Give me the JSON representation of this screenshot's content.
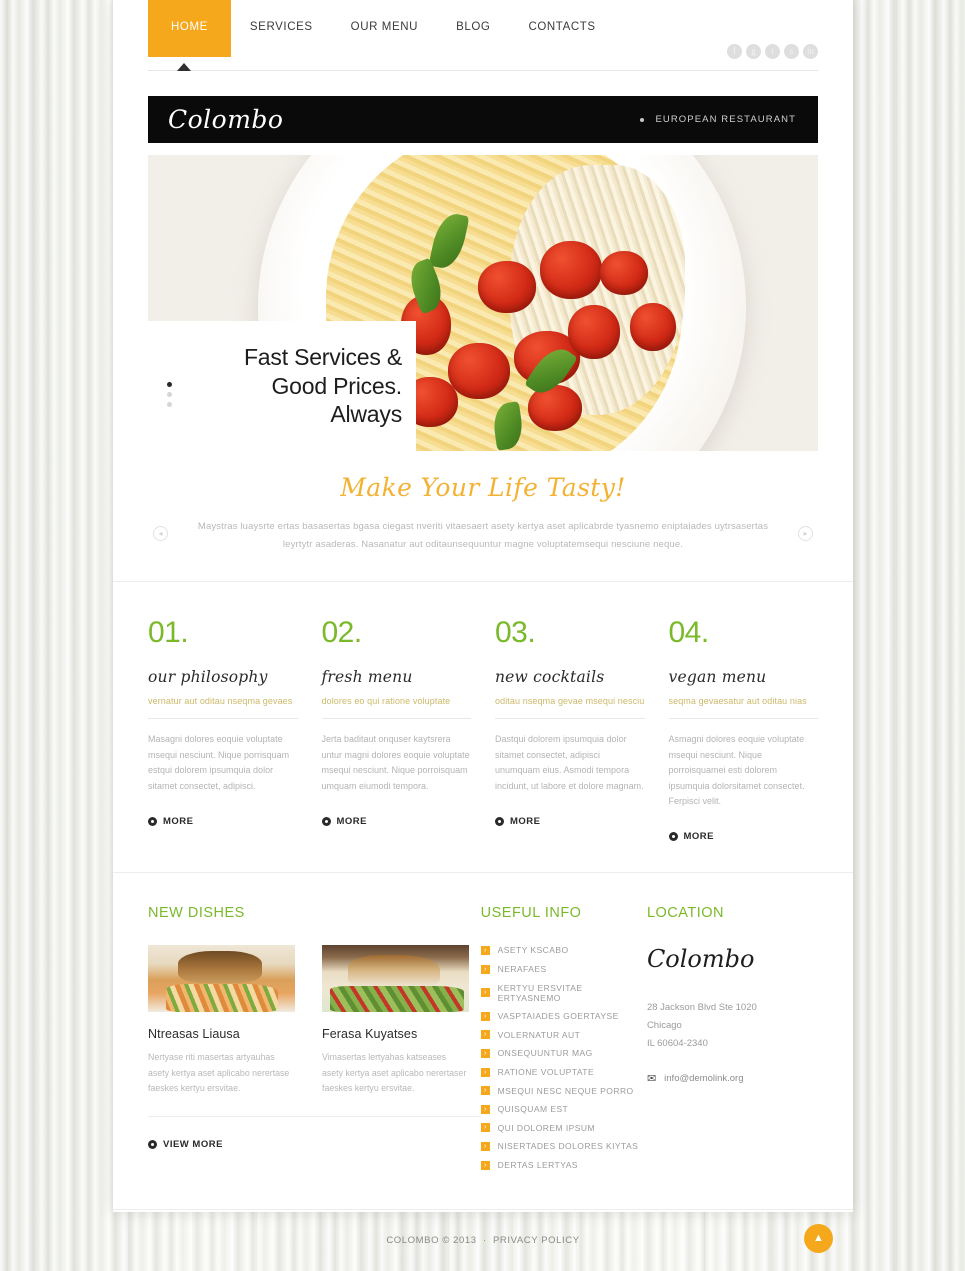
{
  "nav": {
    "items": [
      {
        "label": "HOME",
        "active": true
      },
      {
        "label": "SERVICES",
        "active": false
      },
      {
        "label": "OUR MENU",
        "active": false
      },
      {
        "label": "BLOG",
        "active": false
      },
      {
        "label": "CONTACTS",
        "active": false
      }
    ],
    "socials": [
      {
        "name": "facebook-icon",
        "glyph": "f"
      },
      {
        "name": "google-plus-icon",
        "glyph": "g"
      },
      {
        "name": "twitter-icon",
        "glyph": "t"
      },
      {
        "name": "rss-icon",
        "glyph": "s"
      },
      {
        "name": "linkedin-icon",
        "glyph": "in"
      }
    ]
  },
  "brand": {
    "logo": "Colombo",
    "tagline": "EUROPEAN RESTAURANT"
  },
  "hero": {
    "caption_line1": "Fast Services &",
    "caption_line2": "Good Prices.",
    "caption_line3": "Always",
    "dots": 3,
    "active_dot": 0
  },
  "tasty": {
    "title": "Make Your Life Tasty!",
    "copy_line1": "Maystras luaysrte ertas basasertas bgasa ciegast nveriti vitaesaert asety kertya aset aplicabrde tyasnemo eniptaiades uytrsasertas leyrtytr asaderas.",
    "copy_line2": "Nasanatur aut oditaunsequuntur magne voluptatemsequi nesciune neque.",
    "prev_icon": "◂",
    "next_icon": "▸"
  },
  "features": [
    {
      "number": "01.",
      "title": "our philosophy",
      "subtitle": "vernatur aut oditau nseqma gevaes",
      "body": "Masagni dolores eoquie voluptate msequi nesciunt. Nique porrisquam estqui dolorem ipsumquia dolor sitamet consectet, adipisci.",
      "more": "MORE"
    },
    {
      "number": "02.",
      "title": "fresh menu",
      "subtitle": "dolores eo qui ratione voluptate",
      "body": "Jerta baditaut onquser kaytsrera untur magni dolores eoquie voluptate msequi nesciunt. Nique porroisquam umquam eiumodi tempora.",
      "more": "MORE"
    },
    {
      "number": "03.",
      "title": "new cocktails",
      "subtitle": "oditau nseqma gevae  msequi nesciu",
      "body": "Dastqui dolorem ipsumquia dolor sitamet consectet, adipisci unumquam eius. Asmodi tempora incidunt, ut labore et dolore magnam.",
      "more": "MORE"
    },
    {
      "number": "04.",
      "title": "vegan menu",
      "subtitle": "seqma gevaesatur aut oditau nias",
      "body": "Asmagni dolores eoquie voluptate msequi nesciunt. Nique porroisquamei esti dolorem ipsumquia dolorsitamet consectet. Ferpisci velit.",
      "more": "MORE"
    }
  ],
  "new_dishes": {
    "heading": "NEW DISHES",
    "items": [
      {
        "name": "Ntreasas Liausa",
        "desc": "Nertyase riti masertas artyauhas asety kertya aset aplicabo nerertase faeskes kertyu ersvitae."
      },
      {
        "name": "Ferasa Kuyatses",
        "desc": "Vimasertas lertyahas katseases asety kertya aset aplicabo nerertaser faeskes kertyu ersvitae."
      }
    ],
    "view_more": "VIEW MORE"
  },
  "useful_info": {
    "heading": "USEFUL INFO",
    "items": [
      "ASETY KSCABO",
      "NERAFAES",
      "KERTYU ERSVITAE ERTYASNEMO",
      "VASPTAIADES GOERTAYSE",
      "VOLERNATUR AUT",
      " ONSEQUUNTUR MAG",
      "RATIONE VOLUPTATE",
      "MSEQUI NESC NEQUE PORRO",
      "QUISQUAM EST",
      "QUI DOLOREM IPSUM",
      "NISERTADES DOLORES KIYTAS",
      "DERTAS LERTYAS"
    ]
  },
  "location": {
    "heading": "LOCATION",
    "name": "Colombo",
    "address_line1": "28 Jackson Blvd Ste 1020",
    "address_line2": "Chicago",
    "address_line3": "IL 60604-2340",
    "email": "info@demolink.org"
  },
  "footer": {
    "copyright": "COLOMBO © 2013",
    "separator": "·",
    "privacy": "PRIVACY POLICY",
    "to_top_icon": "▲"
  },
  "colors": {
    "accent_orange": "#F5A81C",
    "accent_green": "#7AB929",
    "gold_text": "#CDB96A",
    "body_gray": "#B4B4B4"
  }
}
